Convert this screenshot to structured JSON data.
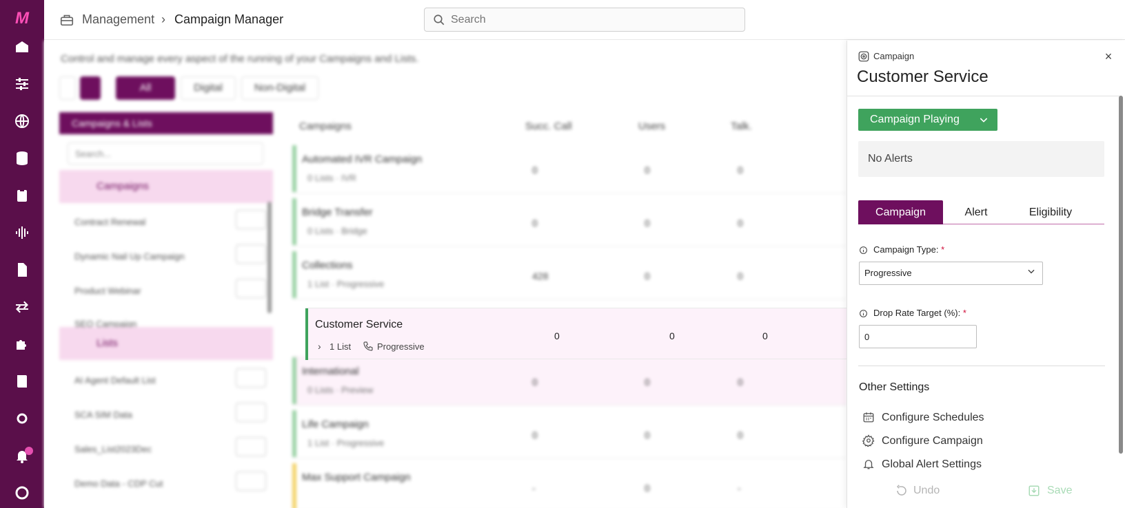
{
  "brand": {
    "logo_text": "M"
  },
  "nav_rail": {
    "icons": [
      "home-icon",
      "sliders-icon",
      "globe-icon",
      "database-icon",
      "clipboard-icon",
      "audio-wave-icon",
      "document-icon",
      "swap-icon",
      "puzzle-icon",
      "book-icon",
      "settings-icon",
      "bell-icon",
      "user-icon"
    ]
  },
  "breadcrumb": {
    "parent": "Management",
    "separator": "›",
    "current": "Campaign Manager"
  },
  "search": {
    "placeholder": "Search"
  },
  "page": {
    "description": "Control and manage every aspect of the running of your Campaigns and Lists.",
    "filters": [
      "All",
      "Digital",
      "Non-Digital"
    ]
  },
  "sidebar": {
    "header": "Campaigns & Lists",
    "search_placeholder": "Search...",
    "campaigns_group": "Campaigns",
    "campaign_items": [
      "Contract Renewal",
      "Dynamic Nail Up Campaign",
      "Product Webinar",
      "SEO Campaign"
    ],
    "lists_group": "Lists",
    "list_items": [
      "AI Agent Default List",
      "SCA SIM Data",
      "Sales_List2023Dec",
      "Demo Data - CDP Cut"
    ]
  },
  "table": {
    "columns": [
      "Campaigns",
      "Succ. Call",
      "Users",
      "Talk."
    ],
    "rows": [
      {
        "name": "Automated IVR Campaign",
        "lists": "0 Lists",
        "mode": "IVR",
        "c1": "0",
        "c2": "0",
        "c3": "0"
      },
      {
        "name": "Bridge Transfer",
        "lists": "0 Lists",
        "mode": "Bridge",
        "c1": "0",
        "c2": "0",
        "c3": "0"
      },
      {
        "name": "Collections",
        "lists": "1 List",
        "mode": "Progressive",
        "c1": "428",
        "c2": "0",
        "c3": "0"
      },
      {
        "name": "International",
        "lists": "0 Lists",
        "mode": "Preview",
        "c1": "0",
        "c2": "0",
        "c3": "0"
      },
      {
        "name": "Life Campaign",
        "lists": "1 List",
        "mode": "Progressive",
        "c1": "0",
        "c2": "0",
        "c3": "0"
      },
      {
        "name": "Max Support Campaign",
        "lists": "",
        "mode": "",
        "c1": "-",
        "c2": "0",
        "c3": "-"
      }
    ],
    "selected_row": {
      "name": "Customer Service",
      "lists": "1 List",
      "mode": "Progressive",
      "c1": "0",
      "c2": "0",
      "c3": "0"
    }
  },
  "panel": {
    "kicker": "Campaign",
    "title": "Customer Service",
    "close_glyph": "×",
    "status_button": "Campaign Playing",
    "alerts_text": "No Alerts",
    "tabs": [
      "Campaign",
      "Alert",
      "Eligibility"
    ],
    "fields": {
      "campaign_type_label": "Campaign Type:",
      "campaign_type_value": "Progressive",
      "drop_rate_label": "Drop Rate Target (%):",
      "drop_rate_value": "0",
      "required_marker": "*"
    },
    "other_settings_title": "Other Settings",
    "links": [
      "Configure Schedules",
      "Configure Campaign",
      "Global Alert Settings"
    ],
    "footer": {
      "undo": "Undo",
      "save": "Save"
    }
  },
  "colors": {
    "brand": "#5a0f4a",
    "accent": "#6e0f5e",
    "playing": "#3fa35d",
    "required": "#d0103a"
  }
}
